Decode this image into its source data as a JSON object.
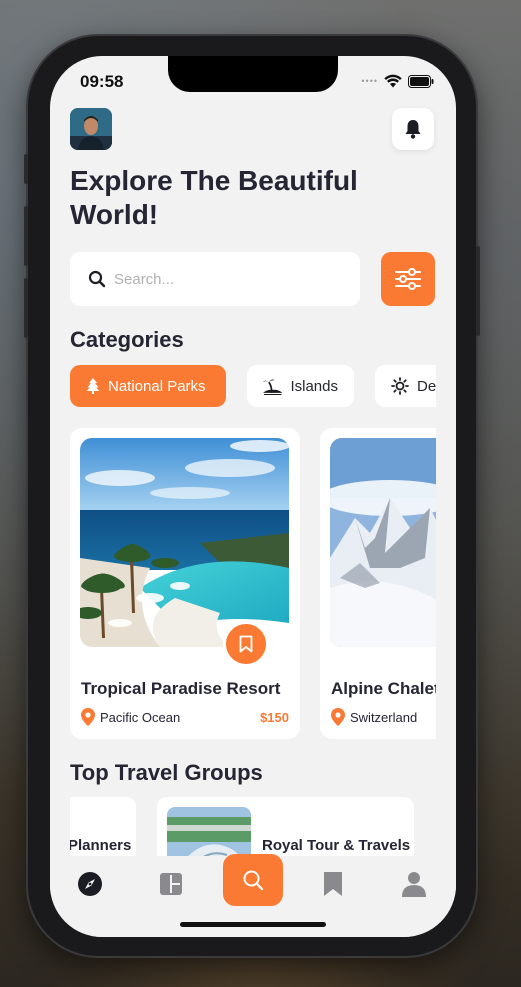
{
  "status_bar": {
    "time": "09:58"
  },
  "colors": {
    "accent": "#fb7a33",
    "text_dark": "#252533",
    "screen_bg": "#f2f2f2"
  },
  "header": {
    "title": "Explore The Beautiful World!",
    "avatar_icon": "user-avatar",
    "notification_icon": "bell-icon"
  },
  "search": {
    "placeholder": "Search...",
    "filter_icon": "sliders-icon"
  },
  "categories": {
    "title": "Categories",
    "items": [
      {
        "label": "National Parks",
        "icon": "tree-icon",
        "active": true
      },
      {
        "label": "Islands",
        "icon": "island-icon",
        "active": false
      },
      {
        "label": "De",
        "icon": "sun-icon",
        "active": false
      }
    ]
  },
  "destinations": [
    {
      "title": "Tropical Paradise Resort",
      "location": "Pacific Ocean",
      "price": "$150"
    },
    {
      "title": "Alpine Chalet",
      "location": "Switzerland",
      "price": ""
    }
  ],
  "travel_groups": {
    "title": "Top Travel Groups",
    "items": [
      {
        "name": "Planners"
      },
      {
        "name": "Royal Tour & Travels"
      }
    ]
  },
  "tabbar": {
    "items": [
      "compass-icon",
      "dashboard-icon",
      "search-icon",
      "bookmark-icon",
      "user-icon"
    ]
  }
}
